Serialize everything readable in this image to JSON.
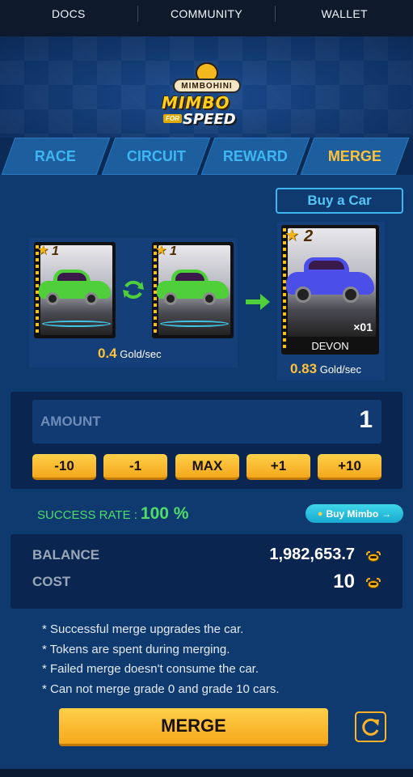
{
  "nav": {
    "items": [
      "DOCS",
      "COMMUNITY",
      "WALLET"
    ]
  },
  "logo": {
    "top": "MIMBOHINI",
    "title": "MIMBO",
    "sub": "SPEED",
    "for": "FOR"
  },
  "tabs": [
    {
      "label": "RACE",
      "active": false
    },
    {
      "label": "CIRCUIT",
      "active": false
    },
    {
      "label": "REWARD",
      "active": false
    },
    {
      "label": "MERGE",
      "active": true
    }
  ],
  "buy_car_label": "Buy a Car",
  "merge": {
    "source_cards": [
      {
        "grade": "1",
        "color": "#4fcf3a"
      },
      {
        "grade": "1",
        "color": "#4fcf3a"
      }
    ],
    "source_gold": {
      "value": "0.4",
      "unit": "Gold/sec"
    },
    "result_card": {
      "grade": "2",
      "name": "DEVON",
      "count": "×01",
      "color": "#4c4ee8"
    },
    "result_gold": {
      "value": "0.83",
      "unit": "Gold/sec"
    }
  },
  "amount": {
    "label": "AMOUNT",
    "value": "1"
  },
  "quick_buttons": [
    "-10",
    "-1",
    "MAX",
    "+1",
    "+10"
  ],
  "success_rate": {
    "label": "SUCCESS RATE :",
    "value": "100 %"
  },
  "buy_mimbo_label": "Buy Mimbo",
  "balance": {
    "label": "BALANCE",
    "value": "1,982,653.7"
  },
  "cost": {
    "label": "COST",
    "value": "10"
  },
  "notes": [
    "* Successful merge upgrades the car.",
    "* Tokens are spent during merging.",
    "* Failed merge doesn't consume the car.",
    "* Can not merge grade 0 and grade 10 cars."
  ],
  "merge_button_label": "MERGE",
  "colors": {
    "accent": "#ffc23a",
    "tab_text": "#3fb6f2",
    "success": "#4fdc6a",
    "panel": "#0f3a70"
  }
}
